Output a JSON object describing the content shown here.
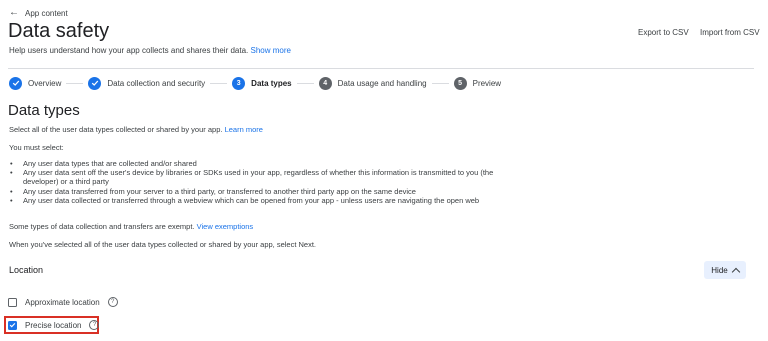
{
  "back": {
    "label": "App content"
  },
  "page": {
    "title": "Data safety",
    "subtitle": "Help users understand how your app collects and shares their data.",
    "subtitle_link": "Show more",
    "export_label": "Export to CSV",
    "import_label": "Import from CSV"
  },
  "stepper": {
    "steps": [
      {
        "label": "Overview",
        "state": "done",
        "number": ""
      },
      {
        "label": "Data collection and security",
        "state": "done",
        "number": ""
      },
      {
        "label": "Data types",
        "state": "active",
        "number": "3"
      },
      {
        "label": "Data usage and handling",
        "state": "pending",
        "number": "4"
      },
      {
        "label": "Preview",
        "state": "pending",
        "number": "5"
      }
    ]
  },
  "section": {
    "heading": "Data types",
    "intro": "Select all of the user data types collected or shared by your app.",
    "intro_link": "Learn more",
    "must_select": "You must select:",
    "bullets": [
      "Any user data types that are collected and/or shared",
      "Any user data sent off the user's device by libraries or SDKs used in your app, regardless of whether this information is transmitted to you (the developer) or a third party",
      "Any user data transferred from your server to a third party, or transferred to another third party app on the same device",
      "Any user data collected or transferred through a webview which can be opened from your app - unless users are navigating the open web"
    ],
    "exempt_text": "Some types of data collection and transfers are exempt.",
    "exempt_link": "View exemptions",
    "next_text": "When you've selected all of the user data types collected or shared by your app, select Next."
  },
  "location": {
    "title": "Location",
    "hide_label": "Hide",
    "options": [
      {
        "label": "Approximate location",
        "checked": false
      },
      {
        "label": "Precise location",
        "checked": true
      }
    ]
  },
  "colors": {
    "accent": "#1a73e8",
    "highlight": "#d93025"
  }
}
